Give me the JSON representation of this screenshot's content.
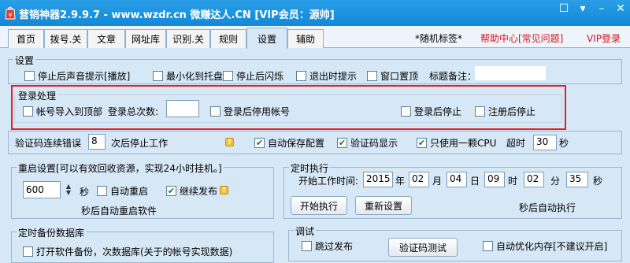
{
  "titlebar": {
    "title": "营销神器2.9.9.7 - www.wzdr.cn 微赚达人.CN [VIP会员：源帅]"
  },
  "tabs": [
    "首页",
    "拨号.关",
    "文章",
    "网址库",
    "识别.关",
    "规则",
    "设置",
    "辅助"
  ],
  "active_tab": "设置",
  "top_links": {
    "random_tag": "*随机标签*",
    "help_center": "帮助中心[常见问题]",
    "vip_login": "VIP登录"
  },
  "settings": {
    "legend": "设置",
    "stop_sound": "停止后声音提示[播放]",
    "minimize_tray": "最小化到托盘",
    "stop_flash": "停止后闪烁",
    "exit_prompt": "退出时提示",
    "window_top": "窗口置顶",
    "title_note_label": "标题备注：",
    "title_note_value": ""
  },
  "login": {
    "legend": "登录处理",
    "import_top": "帐号导入到顶部",
    "total_times_label": "登录总次数:",
    "total_times_value": "",
    "disable_after_login": "登录后停用帐号",
    "stop_after_login": "登录后停止",
    "stop_after_register": "注册后停止"
  },
  "captcha": {
    "error_label": "验证码连续错误",
    "error_value": "8",
    "error_suffix": "次后停止工作",
    "auto_save": "自动保存配置",
    "captcha_show": "验证码显示",
    "single_cpu": "只使用一颗CPU",
    "timeout_label": "超时",
    "timeout_value": "30",
    "timeout_unit": "秒"
  },
  "restart": {
    "legend": "重启设置[可以有效回收资源，实现24小时挂机。]",
    "seconds_value": "600",
    "seconds_unit": "秒",
    "auto_restart": "自动重启",
    "continue_publish": "继续发布",
    "note": "秒后自动重启软件"
  },
  "scheduled": {
    "legend": "定时执行",
    "start_label": "开始工作时间:",
    "year": "2015",
    "year_unit": "年",
    "month": "02",
    "month_unit": "月",
    "day": "04",
    "day_unit": "日",
    "hour": "09",
    "hour_unit": "时",
    "minute": "02",
    "minute_unit": "分",
    "second": "35",
    "second_unit": "秒",
    "start_button": "开始执行",
    "reset_button": "重新设置",
    "note": "秒后自动执行"
  },
  "backup": {
    "legend": "定时备份数据库",
    "partial_text": "打开软件备份，次数据库(关于的帐号实现数据)"
  },
  "debug": {
    "legend": "调试",
    "skip_publish": "跳过发布",
    "captcha_test_button": "验证码测试",
    "auto_optimize": "自动优化内存[不建议开启]"
  }
}
